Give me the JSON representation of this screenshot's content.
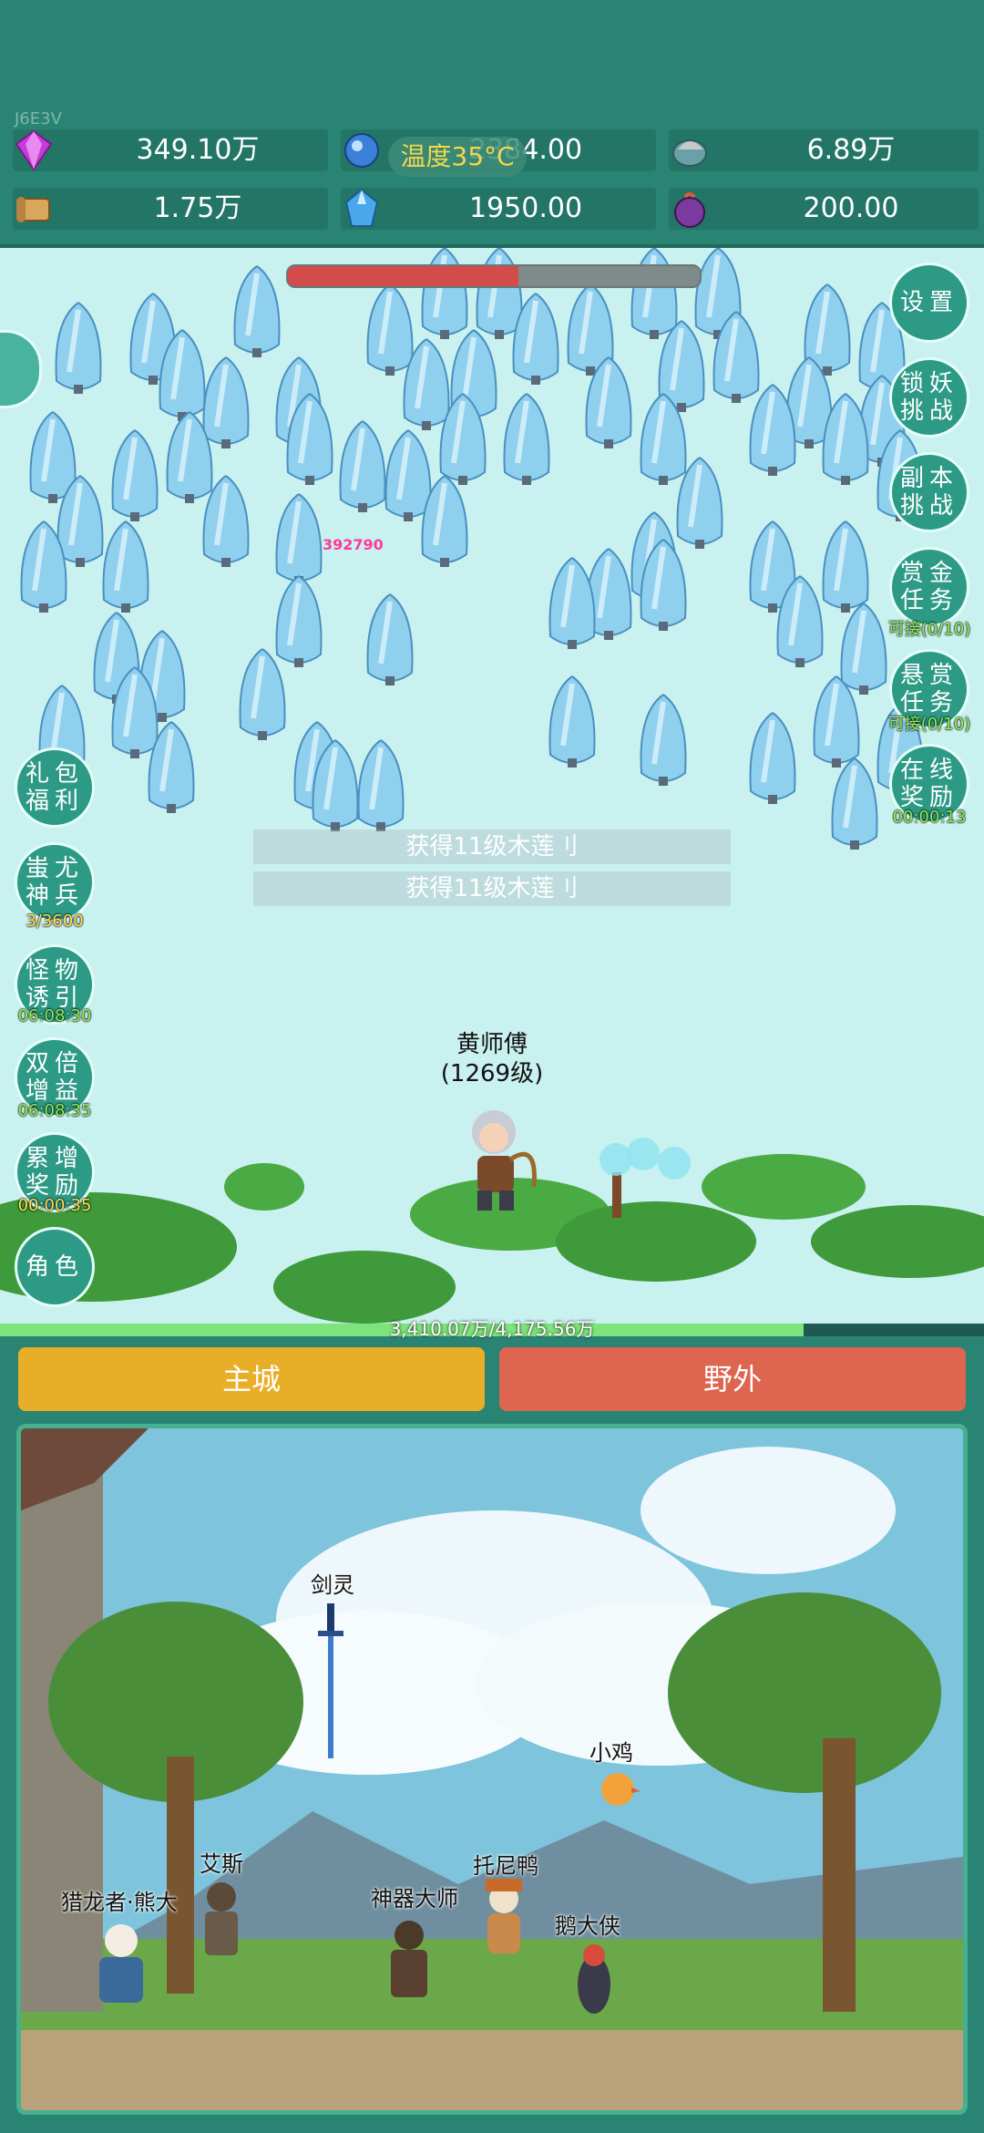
{
  "topbar": {
    "version": "J6E3V",
    "temperature_label": "温度",
    "temperature_value": "35°C",
    "resources": [
      {
        "icon": "diamond-icon",
        "value": "349.10万"
      },
      {
        "icon": "blue-orb-icon",
        "value": "2384.00"
      },
      {
        "icon": "bird-gem-icon",
        "value": "6.89万"
      },
      {
        "icon": "scroll-icon",
        "value": "1.75万"
      },
      {
        "icon": "blue-crystal-icon",
        "value": "1950.00"
      },
      {
        "icon": "purple-fruit-icon",
        "value": "200.00"
      }
    ]
  },
  "battle": {
    "boss_hp_fraction": 0.56,
    "damage_text": "392790",
    "loot_notices": [
      "获得11级木莲刂",
      "获得11级木莲刂"
    ],
    "hero_name": "黄师傅",
    "hero_level": "(1269级)",
    "exp_fraction": 0.817,
    "exp_text": "3,410.07万/4,175.56万"
  },
  "right_buttons": [
    {
      "label": "设置",
      "sub": ""
    },
    {
      "label": "锁妖\n挑战",
      "sub": ""
    },
    {
      "label": "副本\n挑战",
      "sub": ""
    },
    {
      "label": "赏金\n任务",
      "sub": "可接(0/10)"
    },
    {
      "label": "悬赏\n任务",
      "sub": "可接(0/10)"
    },
    {
      "label": "在线\n奖励",
      "sub": "00:00:13"
    }
  ],
  "left_buttons": [
    {
      "label": "礼包\n福利",
      "sub": ""
    },
    {
      "label": "蚩尤\n神兵",
      "sub": "3/3600"
    },
    {
      "label": "怪物\n诱引",
      "sub": "06:08:30"
    },
    {
      "label": "双倍\n增益",
      "sub": "06:08:35"
    },
    {
      "label": "累增\n奖励",
      "sub": "00:00:35"
    },
    {
      "label": "角色",
      "sub": ""
    }
  ],
  "tabs": {
    "main_city": "主城",
    "wild": "野外"
  },
  "tab_colors": {
    "main_city": "#e9ae28",
    "wild": "#de654f"
  },
  "scene": {
    "npcs": [
      "剑灵",
      "小鸡",
      "艾斯",
      "托尼鸭",
      "猎龙者·熊大",
      "神器大师",
      "鹅大侠"
    ]
  }
}
